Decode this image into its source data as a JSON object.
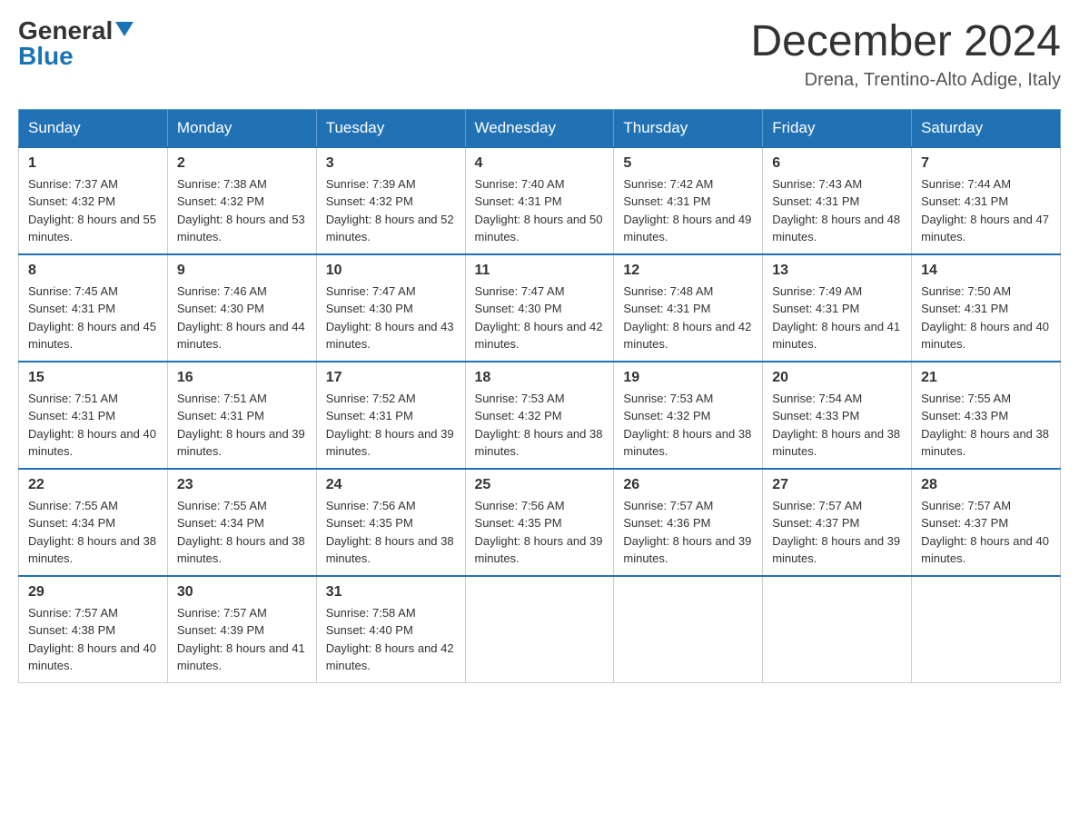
{
  "header": {
    "logo_general": "General",
    "logo_blue": "Blue",
    "month_title": "December 2024",
    "subtitle": "Drena, Trentino-Alto Adige, Italy"
  },
  "weekdays": [
    "Sunday",
    "Monday",
    "Tuesday",
    "Wednesday",
    "Thursday",
    "Friday",
    "Saturday"
  ],
  "weeks": [
    [
      {
        "day": "1",
        "sunrise": "7:37 AM",
        "sunset": "4:32 PM",
        "daylight": "8 hours and 55 minutes."
      },
      {
        "day": "2",
        "sunrise": "7:38 AM",
        "sunset": "4:32 PM",
        "daylight": "8 hours and 53 minutes."
      },
      {
        "day": "3",
        "sunrise": "7:39 AM",
        "sunset": "4:32 PM",
        "daylight": "8 hours and 52 minutes."
      },
      {
        "day": "4",
        "sunrise": "7:40 AM",
        "sunset": "4:31 PM",
        "daylight": "8 hours and 50 minutes."
      },
      {
        "day": "5",
        "sunrise": "7:42 AM",
        "sunset": "4:31 PM",
        "daylight": "8 hours and 49 minutes."
      },
      {
        "day": "6",
        "sunrise": "7:43 AM",
        "sunset": "4:31 PM",
        "daylight": "8 hours and 48 minutes."
      },
      {
        "day": "7",
        "sunrise": "7:44 AM",
        "sunset": "4:31 PM",
        "daylight": "8 hours and 47 minutes."
      }
    ],
    [
      {
        "day": "8",
        "sunrise": "7:45 AM",
        "sunset": "4:31 PM",
        "daylight": "8 hours and 45 minutes."
      },
      {
        "day": "9",
        "sunrise": "7:46 AM",
        "sunset": "4:30 PM",
        "daylight": "8 hours and 44 minutes."
      },
      {
        "day": "10",
        "sunrise": "7:47 AM",
        "sunset": "4:30 PM",
        "daylight": "8 hours and 43 minutes."
      },
      {
        "day": "11",
        "sunrise": "7:47 AM",
        "sunset": "4:30 PM",
        "daylight": "8 hours and 42 minutes."
      },
      {
        "day": "12",
        "sunrise": "7:48 AM",
        "sunset": "4:31 PM",
        "daylight": "8 hours and 42 minutes."
      },
      {
        "day": "13",
        "sunrise": "7:49 AM",
        "sunset": "4:31 PM",
        "daylight": "8 hours and 41 minutes."
      },
      {
        "day": "14",
        "sunrise": "7:50 AM",
        "sunset": "4:31 PM",
        "daylight": "8 hours and 40 minutes."
      }
    ],
    [
      {
        "day": "15",
        "sunrise": "7:51 AM",
        "sunset": "4:31 PM",
        "daylight": "8 hours and 40 minutes."
      },
      {
        "day": "16",
        "sunrise": "7:51 AM",
        "sunset": "4:31 PM",
        "daylight": "8 hours and 39 minutes."
      },
      {
        "day": "17",
        "sunrise": "7:52 AM",
        "sunset": "4:31 PM",
        "daylight": "8 hours and 39 minutes."
      },
      {
        "day": "18",
        "sunrise": "7:53 AM",
        "sunset": "4:32 PM",
        "daylight": "8 hours and 38 minutes."
      },
      {
        "day": "19",
        "sunrise": "7:53 AM",
        "sunset": "4:32 PM",
        "daylight": "8 hours and 38 minutes."
      },
      {
        "day": "20",
        "sunrise": "7:54 AM",
        "sunset": "4:33 PM",
        "daylight": "8 hours and 38 minutes."
      },
      {
        "day": "21",
        "sunrise": "7:55 AM",
        "sunset": "4:33 PM",
        "daylight": "8 hours and 38 minutes."
      }
    ],
    [
      {
        "day": "22",
        "sunrise": "7:55 AM",
        "sunset": "4:34 PM",
        "daylight": "8 hours and 38 minutes."
      },
      {
        "day": "23",
        "sunrise": "7:55 AM",
        "sunset": "4:34 PM",
        "daylight": "8 hours and 38 minutes."
      },
      {
        "day": "24",
        "sunrise": "7:56 AM",
        "sunset": "4:35 PM",
        "daylight": "8 hours and 38 minutes."
      },
      {
        "day": "25",
        "sunrise": "7:56 AM",
        "sunset": "4:35 PM",
        "daylight": "8 hours and 39 minutes."
      },
      {
        "day": "26",
        "sunrise": "7:57 AM",
        "sunset": "4:36 PM",
        "daylight": "8 hours and 39 minutes."
      },
      {
        "day": "27",
        "sunrise": "7:57 AM",
        "sunset": "4:37 PM",
        "daylight": "8 hours and 39 minutes."
      },
      {
        "day": "28",
        "sunrise": "7:57 AM",
        "sunset": "4:37 PM",
        "daylight": "8 hours and 40 minutes."
      }
    ],
    [
      {
        "day": "29",
        "sunrise": "7:57 AM",
        "sunset": "4:38 PM",
        "daylight": "8 hours and 40 minutes."
      },
      {
        "day": "30",
        "sunrise": "7:57 AM",
        "sunset": "4:39 PM",
        "daylight": "8 hours and 41 minutes."
      },
      {
        "day": "31",
        "sunrise": "7:58 AM",
        "sunset": "4:40 PM",
        "daylight": "8 hours and 42 minutes."
      },
      null,
      null,
      null,
      null
    ]
  ]
}
